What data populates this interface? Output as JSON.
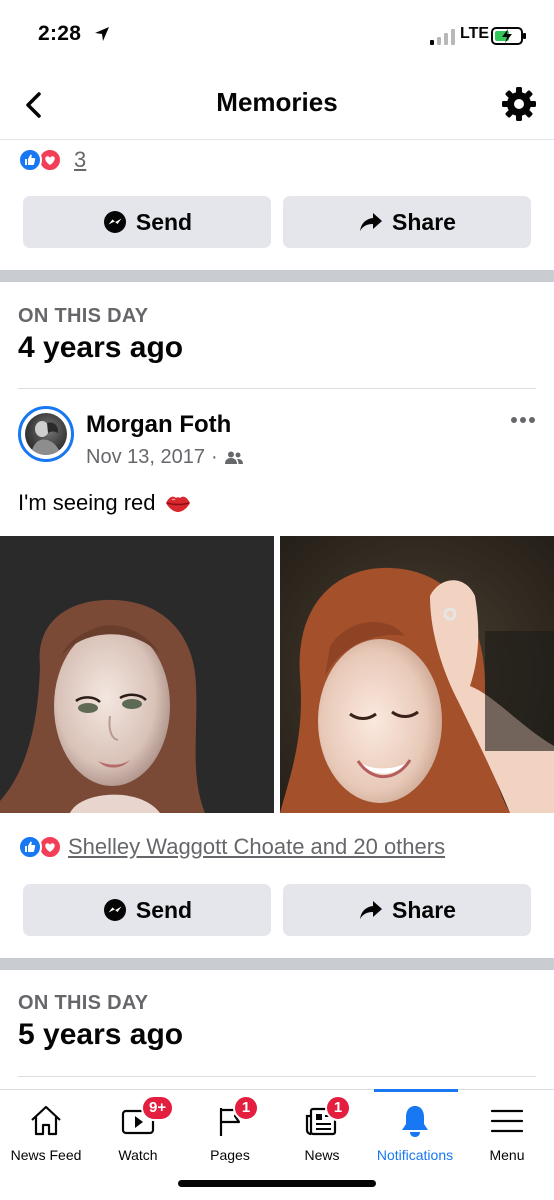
{
  "status_bar": {
    "time": "2:28",
    "network": "LTE"
  },
  "header": {
    "title": "Memories",
    "back_icon": "chevron-left-icon",
    "settings_icon": "gear-icon"
  },
  "top_post": {
    "reaction_count": "3",
    "send_label": "Send",
    "share_label": "Share"
  },
  "memory_1": {
    "section_label": "ON THIS DAY",
    "years_ago": "4 years ago",
    "author": "Morgan Foth",
    "date": "Nov 13, 2017",
    "date_separator": "·",
    "audience_icon": "friends-icon",
    "text": "I'm seeing red",
    "emoji_icon": "kiss-lips-icon",
    "reactions_text": "Shelley Waggott Choate and 20 others",
    "send_label": "Send",
    "share_label": "Share"
  },
  "memory_2": {
    "section_label": "ON THIS DAY",
    "years_ago": "5 years ago"
  },
  "bottom_nav": {
    "items": [
      {
        "label": "News Feed",
        "icon": "home-icon",
        "badge": ""
      },
      {
        "label": "Watch",
        "icon": "video-icon",
        "badge": "9+"
      },
      {
        "label": "Pages",
        "icon": "flag-icon",
        "badge": "1"
      },
      {
        "label": "News",
        "icon": "newspaper-icon",
        "badge": "1"
      },
      {
        "label": "Notifications",
        "icon": "bell-icon",
        "badge": "",
        "active": true
      },
      {
        "label": "Menu",
        "icon": "hamburger-icon",
        "badge": ""
      }
    ]
  },
  "colors": {
    "accent": "#1877f2",
    "badge": "#e41e3f",
    "button_bg": "#e4e6eb",
    "secondary_text": "#65676b",
    "separator": "#c9ccd1"
  }
}
